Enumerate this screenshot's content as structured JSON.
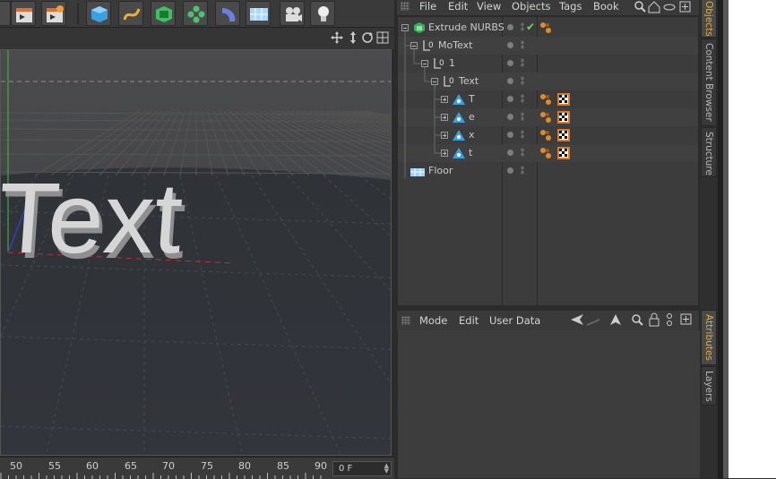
{
  "om_menu": [
    "File",
    "Edit",
    "View",
    "Objects",
    "Tags",
    "Book"
  ],
  "am_menu": [
    "Mode",
    "Edit",
    "User Data"
  ],
  "side_tabs": {
    "objects": "Objects",
    "content_browser": "Content Browser",
    "structure": "Structure",
    "attributes": "Attributes",
    "layers": "Layers"
  },
  "objects": [
    {
      "name": "Extrude NURBS",
      "icon": "extrude-nurbs-icon",
      "check": "✔"
    },
    {
      "name": "MoText",
      "icon": "null-object-icon"
    },
    {
      "name": "1",
      "icon": "null-object-icon"
    },
    {
      "name": "Text",
      "icon": "null-object-icon"
    },
    {
      "name": "T",
      "icon": "spline-icon"
    },
    {
      "name": "e",
      "icon": "spline-icon"
    },
    {
      "name": "x",
      "icon": "spline-icon"
    },
    {
      "name": "t",
      "icon": "spline-icon"
    },
    {
      "name": "Floor",
      "icon": "floor-icon"
    }
  ],
  "viewport": {
    "text3d": "Text"
  },
  "timeline": {
    "ticks": [
      "50",
      "55",
      "60",
      "65",
      "70",
      "75",
      "80",
      "85",
      "90"
    ],
    "frame": "0 F"
  },
  "colors": {
    "accent": "#e0b040",
    "check": "#6fd06f",
    "panel": "#3c3c3c"
  }
}
